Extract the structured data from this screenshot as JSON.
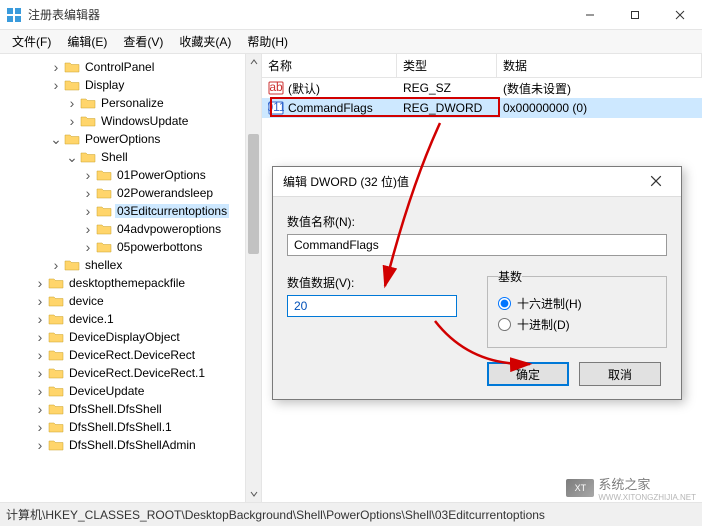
{
  "window": {
    "title": "注册表编辑器",
    "min": "—",
    "max": "☐",
    "close": "✕"
  },
  "menu": {
    "file": "文件(F)",
    "edit": "编辑(E)",
    "view": "查看(V)",
    "fav": "收藏夹(A)",
    "help": "帮助(H)"
  },
  "tree": [
    {
      "indent": 3,
      "tw": ">",
      "label": "ControlPanel"
    },
    {
      "indent": 3,
      "tw": ">",
      "label": "Display"
    },
    {
      "indent": 4,
      "tw": ">",
      "label": "Personalize"
    },
    {
      "indent": 4,
      "tw": ">",
      "label": "WindowsUpdate"
    },
    {
      "indent": 3,
      "tw": "v",
      "label": "PowerOptions"
    },
    {
      "indent": 4,
      "tw": "v",
      "label": "Shell"
    },
    {
      "indent": 5,
      "tw": ">",
      "label": "01PowerOptions"
    },
    {
      "indent": 5,
      "tw": ">",
      "label": "02Powerandsleep"
    },
    {
      "indent": 5,
      "tw": ">",
      "label": "03Editcurrentoptions",
      "sel": true
    },
    {
      "indent": 5,
      "tw": ">",
      "label": "04advpoweroptions"
    },
    {
      "indent": 5,
      "tw": ">",
      "label": "05powerbottons"
    },
    {
      "indent": 3,
      "tw": ">",
      "label": "shellex"
    },
    {
      "indent": 2,
      "tw": ">",
      "label": "desktopthemepackfile"
    },
    {
      "indent": 2,
      "tw": ">",
      "label": "device"
    },
    {
      "indent": 2,
      "tw": ">",
      "label": "device.1"
    },
    {
      "indent": 2,
      "tw": ">",
      "label": "DeviceDisplayObject"
    },
    {
      "indent": 2,
      "tw": ">",
      "label": "DeviceRect.DeviceRect"
    },
    {
      "indent": 2,
      "tw": ">",
      "label": "DeviceRect.DeviceRect.1"
    },
    {
      "indent": 2,
      "tw": ">",
      "label": "DeviceUpdate"
    },
    {
      "indent": 2,
      "tw": ">",
      "label": "DfsShell.DfsShell"
    },
    {
      "indent": 2,
      "tw": ">",
      "label": "DfsShell.DfsShell.1"
    },
    {
      "indent": 2,
      "tw": ">",
      "label": "DfsShell.DfsShellAdmin"
    }
  ],
  "list": {
    "headers": {
      "name": "名称",
      "type": "类型",
      "data": "数据"
    },
    "rows": [
      {
        "icon": "sz",
        "name": "(默认)",
        "type": "REG_SZ",
        "data": "(数值未设置)",
        "sel": false
      },
      {
        "icon": "dw",
        "name": "CommandFlags",
        "type": "REG_DWORD",
        "data": "0x00000000 (0)",
        "sel": true
      }
    ]
  },
  "dialog": {
    "title": "编辑 DWORD (32 位)值",
    "name_label": "数值名称(N):",
    "name_value": "CommandFlags",
    "data_label": "数值数据(V):",
    "data_value": "20",
    "base_label": "基数",
    "hex": "十六进制(H)",
    "dec": "十进制(D)",
    "ok": "确定",
    "cancel": "取消"
  },
  "status": {
    "path": "计算机\\HKEY_CLASSES_ROOT\\DesktopBackground\\Shell\\PowerOptions\\Shell\\03Editcurrentoptions"
  },
  "watermark": {
    "text": "系统之家",
    "url": "WWW.XITONGZHIJIA.NET"
  }
}
